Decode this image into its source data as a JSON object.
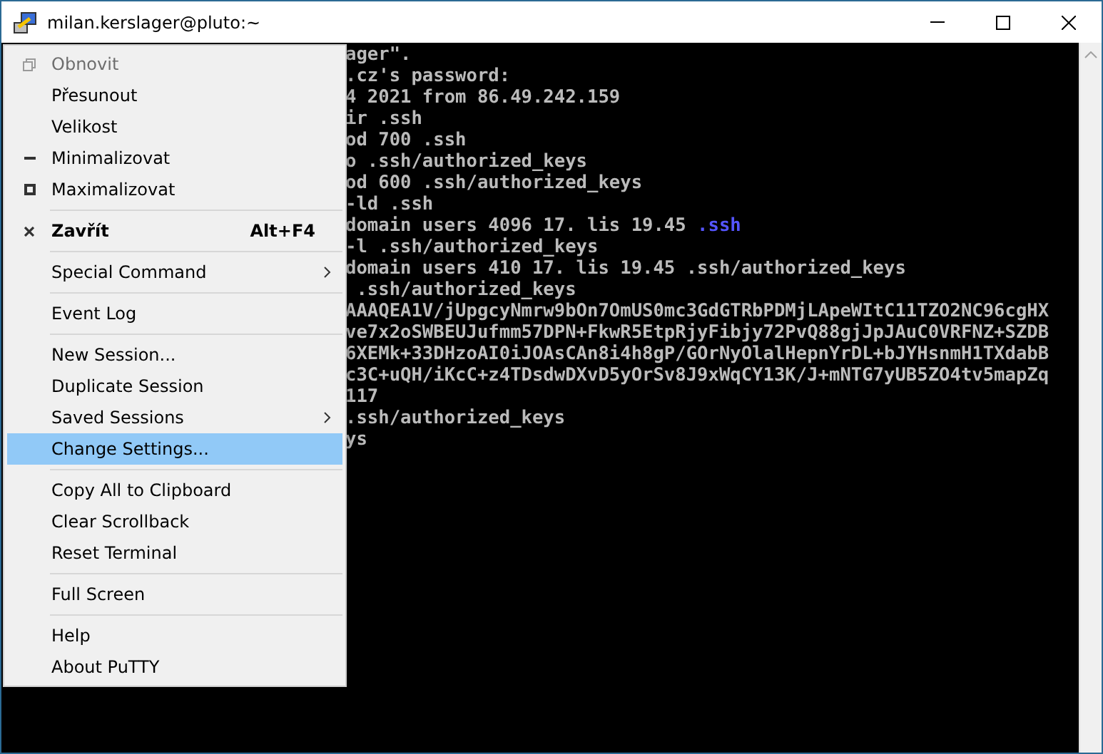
{
  "window": {
    "title": "milan.kerslager@pluto:~"
  },
  "terminal": {
    "lines": [
      [
        {
          "text": "ager\".",
          "kind": "plain"
        }
      ],
      [
        {
          "text": ".cz's password:",
          "kind": "plain"
        }
      ],
      [
        {
          "text": "4 2021 from 86.49.242.159",
          "kind": "plain"
        }
      ],
      [
        {
          "text": "ir .ssh",
          "kind": "plain"
        }
      ],
      [
        {
          "text": "od 700 .ssh",
          "kind": "plain"
        }
      ],
      [
        {
          "text": "o .ssh/authorized_keys",
          "kind": "plain"
        }
      ],
      [
        {
          "text": "od 600 .ssh/authorized_keys",
          "kind": "plain"
        }
      ],
      [
        {
          "text": "-ld .ssh",
          "kind": "plain"
        }
      ],
      [
        {
          "text": "domain users 4096 17. lis 19.45 ",
          "kind": "plain"
        },
        {
          "text": ".ssh",
          "kind": "directory"
        }
      ],
      [
        {
          "text": "-l .ssh/authorized_keys",
          "kind": "plain"
        }
      ],
      [
        {
          "text": "domain users 410 17. lis 19.45 .ssh/authorized_keys",
          "kind": "plain"
        }
      ],
      [
        {
          "text": " .ssh/authorized_keys",
          "kind": "plain"
        }
      ],
      [
        {
          "text": "AAAQEA1V/jUpgcyNmrw9bOn7OmUS0mc3GdGTRbPDMjLApeWItC11TZO2NC96cgHX",
          "kind": "plain"
        }
      ],
      [
        {
          "text": "ve7x2oSWBEUJufmm57DPN+FkwR5EtpRjyFibjy72PvQ88gjJpJAuC0VRFNZ+SZDB",
          "kind": "plain"
        }
      ],
      [
        {
          "text": "6XEMk+33DHzoAI0iJOAsCAn8i4h8gP/GOrNyOlalHepnYrDL+bJYHsnmH1TXdabB",
          "kind": "plain"
        }
      ],
      [
        {
          "text": "c3C+uQH/iKcC+z4TDsdwDXvD5yOrSv8J9xWqCY13K/J+mNTG7yUB5ZO4tv5mapZq",
          "kind": "plain"
        }
      ],
      [
        {
          "text": "117",
          "kind": "plain"
        }
      ],
      [
        {
          "text": ".ssh/authorized_keys",
          "kind": "plain"
        }
      ],
      [
        {
          "text": "ys",
          "kind": "plain"
        }
      ]
    ]
  },
  "menu": {
    "items": [
      {
        "kind": "restore",
        "label": "Obnovit",
        "disabled": true,
        "selected": false
      },
      {
        "kind": "item",
        "label": "Přesunout",
        "disabled": false,
        "selected": false
      },
      {
        "kind": "item",
        "label": "Velikost",
        "disabled": false,
        "selected": false
      },
      {
        "kind": "minimize",
        "label": "Minimalizovat",
        "disabled": false,
        "selected": false
      },
      {
        "kind": "maximize",
        "label": "Maximalizovat",
        "disabled": false,
        "selected": false
      },
      {
        "kind": "separator"
      },
      {
        "kind": "close",
        "label": "Zavřít",
        "default": true,
        "shortcut": "Alt+F4",
        "disabled": false,
        "selected": false
      },
      {
        "kind": "separator"
      },
      {
        "kind": "item",
        "label": "Special Command",
        "submenu": true,
        "disabled": false,
        "selected": false
      },
      {
        "kind": "separator"
      },
      {
        "kind": "item",
        "label": "Event Log",
        "disabled": false,
        "selected": false
      },
      {
        "kind": "separator"
      },
      {
        "kind": "item",
        "label": "New Session...",
        "disabled": false,
        "selected": false
      },
      {
        "kind": "item",
        "label": "Duplicate Session",
        "disabled": false,
        "selected": false
      },
      {
        "kind": "item",
        "label": "Saved Sessions",
        "submenu": true,
        "disabled": false,
        "selected": false
      },
      {
        "kind": "item",
        "label": "Change Settings...",
        "disabled": false,
        "selected": true
      },
      {
        "kind": "separator"
      },
      {
        "kind": "item",
        "label": "Copy All to Clipboard",
        "disabled": false,
        "selected": false
      },
      {
        "kind": "item",
        "label": "Clear Scrollback",
        "disabled": false,
        "selected": false
      },
      {
        "kind": "item",
        "label": "Reset Terminal",
        "disabled": false,
        "selected": false
      },
      {
        "kind": "separator"
      },
      {
        "kind": "item",
        "label": "Full Screen",
        "disabled": false,
        "selected": false
      },
      {
        "kind": "separator"
      },
      {
        "kind": "item",
        "label": "Help",
        "disabled": false,
        "selected": false
      },
      {
        "kind": "item",
        "label": "About PuTTY",
        "disabled": false,
        "selected": false
      }
    ]
  }
}
